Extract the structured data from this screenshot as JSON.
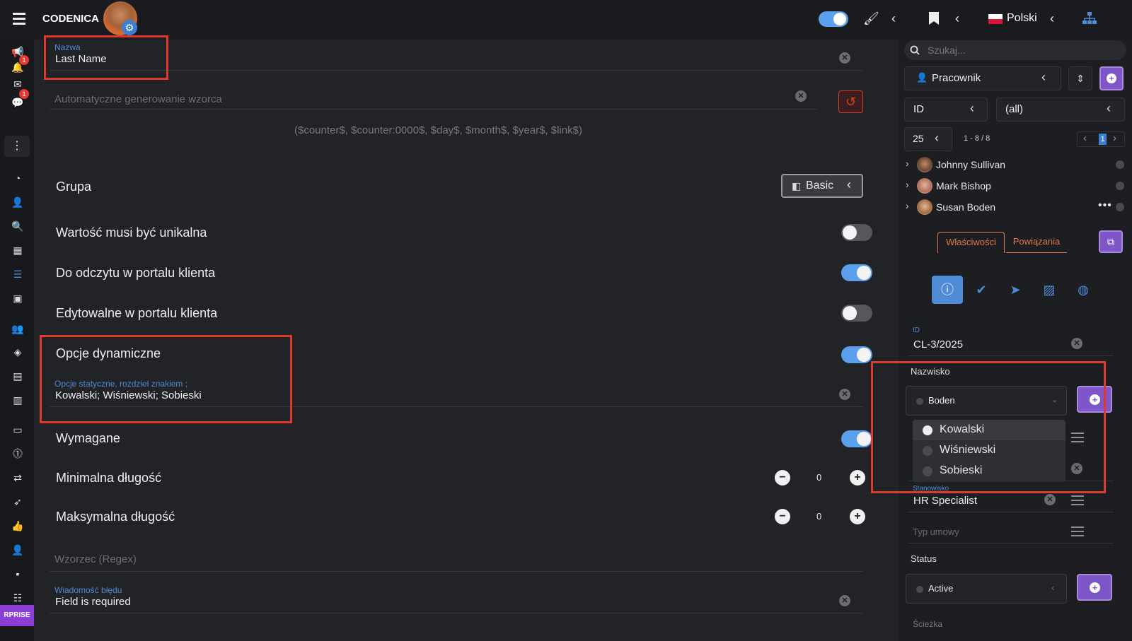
{
  "topbar": {
    "brand": "CODENICA",
    "language": "Polski",
    "colors": {
      "accent": "#5aa0ec",
      "purple": "#7e56c7",
      "highlight": "#e0392b"
    }
  },
  "sidebar": {
    "notifications_badge": "1",
    "chat_badge": "1",
    "enterprise_label": "RPRISE"
  },
  "form": {
    "name_label": "Nazwa",
    "name_value": "Last Name",
    "auto_pattern_placeholder": "Automatyczne generowanie wzorca",
    "pattern_hint": "($counter$, $counter:0000$, $day$, $month$, $year$, $link$)",
    "group_label": "Grupa",
    "group_value": "Basic",
    "unique_label": "Wartość musi być unikalna",
    "unique_on": false,
    "readonly_portal_label": "Do odczytu w portalu klienta",
    "readonly_portal_on": true,
    "editable_portal_label": "Edytowalne w portalu klienta",
    "editable_portal_on": false,
    "dynamic_options_label": "Opcje dynamiczne",
    "dynamic_options_on": true,
    "static_options_label": "Opcje statyczne, rozdziel znakiem ;",
    "static_options_value": "Kowalski; Wiśniewski; Sobieski",
    "required_label": "Wymagane",
    "required_on": true,
    "min_length_label": "Minimalna długość",
    "min_length_value": "0",
    "max_length_label": "Maksymalna długość",
    "max_length_value": "0",
    "regex_placeholder": "Wzorzec (Regex)",
    "error_msg_label": "Wiadomość błędu",
    "error_msg_value": "Field is required"
  },
  "right": {
    "search_placeholder": "Szukaj...",
    "entity_select": "Pracownik",
    "field_select": "ID",
    "filter_select": "(all)",
    "page_size": "25",
    "range": "1 - 8 / 8",
    "current_page": "1",
    "people": [
      "Johnny Sullivan",
      "Mark Bishop",
      "Susan Boden"
    ],
    "tab_properties": "Właściwości",
    "tab_relations": "Powiązania",
    "id_label": "ID",
    "id_value": "CL-3/2025",
    "surname_label": "Nazwisko",
    "surname_value": "Boden",
    "dropdown_options": [
      "Kowalski",
      "Wiśniewski",
      "Sobieski"
    ],
    "position_label": "Stanowisko",
    "position_value": "HR Specialist",
    "contract_placeholder": "Typ umowy",
    "status_label": "Status",
    "status_value": "Active",
    "path_label": "Ścieżka"
  }
}
